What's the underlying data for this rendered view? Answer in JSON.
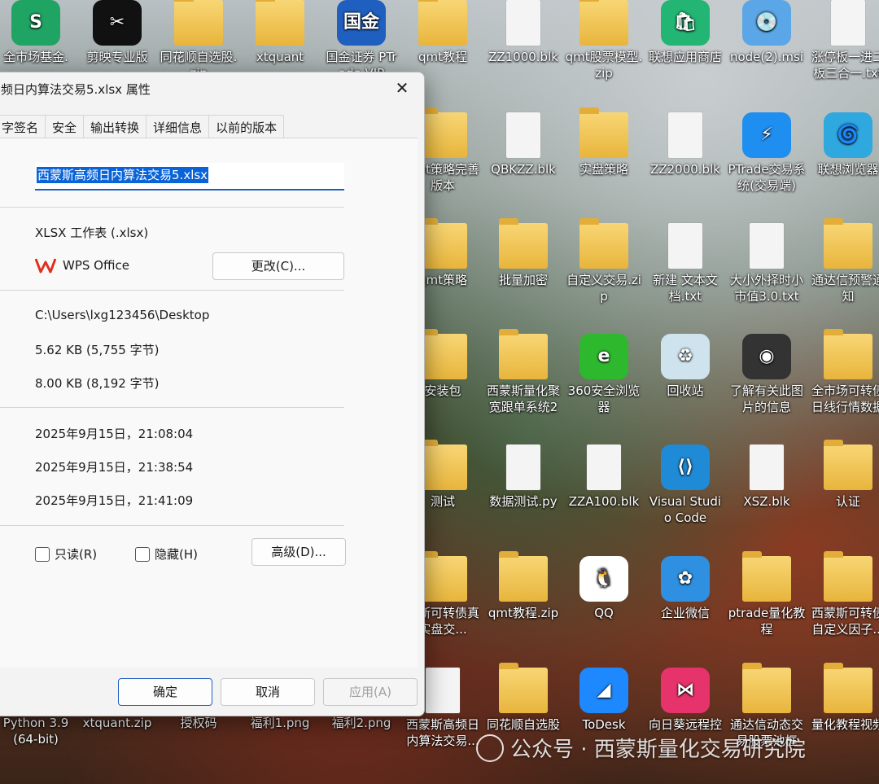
{
  "desktop": {
    "icons": [
      {
        "label": "全市场基金.",
        "kind": "app",
        "color": "#1fa463",
        "glyph": "S"
      },
      {
        "label": "剪映专业版",
        "kind": "app",
        "color": "#111111",
        "glyph": "✂"
      },
      {
        "label": "同花顺自选股.zip",
        "kind": "folder"
      },
      {
        "label": "xtquant",
        "kind": "folder"
      },
      {
        "label": "国金证券 PTrade VIP",
        "kind": "app",
        "color": "#1f5fbf",
        "glyph": "国金"
      },
      {
        "label": "qmt教程",
        "kind": "folder"
      },
      {
        "label": "ZZ1000.blk",
        "kind": "file"
      },
      {
        "label": "qmt股票模型.zip",
        "kind": "folder"
      },
      {
        "label": "联想应用商店",
        "kind": "app",
        "color": "#22b573",
        "glyph": "🛍"
      },
      {
        "label": "node(2).msi",
        "kind": "app",
        "color": "#5aa6e6",
        "glyph": "💿"
      },
      {
        "label": "涨停板一进二板三合一.txt",
        "kind": "file"
      },
      {
        "label": "qmt策略完善版本",
        "kind": "folder"
      },
      {
        "label": "QBKZZ.blk",
        "kind": "file"
      },
      {
        "label": "实盘策略",
        "kind": "folder"
      },
      {
        "label": "ZZ2000.blk",
        "kind": "file"
      },
      {
        "label": "PTrade交易系统(交易端)",
        "kind": "app",
        "color": "#1f8ef1",
        "glyph": "⚡"
      },
      {
        "label": "联想浏览器",
        "kind": "app",
        "color": "#2fa8e0",
        "glyph": "🌀"
      },
      {
        "label": "qmt策略",
        "kind": "folder"
      },
      {
        "label": "批量加密",
        "kind": "folder"
      },
      {
        "label": "自定义交易.zip",
        "kind": "folder"
      },
      {
        "label": "新建 文本文档.txt",
        "kind": "file"
      },
      {
        "label": "大小外择时小市值3.0.txt",
        "kind": "file"
      },
      {
        "label": "通达信预警通知",
        "kind": "folder"
      },
      {
        "label": "安装包",
        "kind": "folder"
      },
      {
        "label": "西蒙斯量化聚宽跟单系统2",
        "kind": "folder"
      },
      {
        "label": "360安全浏览器",
        "kind": "app",
        "color": "#2eb82e",
        "glyph": "e"
      },
      {
        "label": "回收站",
        "kind": "app",
        "color": "#cfe3ef",
        "glyph": "♻"
      },
      {
        "label": "了解有关此图片的信息",
        "kind": "app",
        "color": "#333333",
        "glyph": "◉"
      },
      {
        "label": "全市场可转债日线行情数据",
        "kind": "folder"
      },
      {
        "label": "测试",
        "kind": "folder"
      },
      {
        "label": "数据测试.py",
        "kind": "file"
      },
      {
        "label": "ZZA100.blk",
        "kind": "file"
      },
      {
        "label": "Visual Studio Code",
        "kind": "app",
        "color": "#1f8ad6",
        "glyph": "⟨⟩"
      },
      {
        "label": "XSZ.blk",
        "kind": "file"
      },
      {
        "label": "认证",
        "kind": "folder"
      },
      {
        "label": "蒙斯可转债真实盘交...",
        "kind": "folder"
      },
      {
        "label": "qmt教程.zip",
        "kind": "folder"
      },
      {
        "label": "QQ",
        "kind": "app",
        "color": "#ffffff",
        "glyph": "🐧"
      },
      {
        "label": "企业微信",
        "kind": "app",
        "color": "#2f8fe0",
        "glyph": "✿"
      },
      {
        "label": "ptrade量化教程",
        "kind": "folder"
      },
      {
        "label": "西蒙斯可转债自定义因子...",
        "kind": "folder"
      },
      {
        "label": "Python 3.9 (64-bit)",
        "kind": "none"
      },
      {
        "label": "xtquant.zip",
        "kind": "none"
      },
      {
        "label": "授权码",
        "kind": "none"
      },
      {
        "label": "福利1.png",
        "kind": "none"
      },
      {
        "label": "福利2.png",
        "kind": "none"
      },
      {
        "label": "西蒙斯高频日内算法交易...",
        "kind": "file"
      },
      {
        "label": "同花顺自选股",
        "kind": "folder"
      },
      {
        "label": "ToDesk",
        "kind": "app",
        "color": "#1e88ff",
        "glyph": "◢"
      },
      {
        "label": "向日葵远程控",
        "kind": "app",
        "color": "#e6336b",
        "glyph": "⋈"
      },
      {
        "label": "通达信动态交易股票池框",
        "kind": "folder"
      },
      {
        "label": "量化教程视频",
        "kind": "folder"
      }
    ]
  },
  "dialog": {
    "title": "频日内算法交易5.xlsx 属性",
    "close": "✕",
    "tabs": [
      "字签名",
      "安全",
      "输出转换",
      "详细信息",
      "以前的版本"
    ],
    "filename": "西蒙斯高频日内算法交易5.xlsx",
    "file_type": "XLSX 工作表 (.xlsx)",
    "open_with": "WPS Office",
    "change_button": "更改(C)...",
    "location": "C:\\Users\\lxg123456\\Desktop",
    "size": "5.62 KB (5,755 字节)",
    "size_on_disk": "8.00 KB (8,192 字节)",
    "created": "2025年9月15日，21:08:04",
    "modified": "2025年9月15日，21:38:54",
    "accessed": "2025年9月15日，21:41:09",
    "readonly_label": "只读(R)",
    "hidden_label": "隐藏(H)",
    "advanced_button": "高级(D)...",
    "ok_button": "确定",
    "cancel_button": "取消",
    "apply_button": "应用(A)"
  },
  "watermark": "公众号 · 西蒙斯量化交易研究院"
}
